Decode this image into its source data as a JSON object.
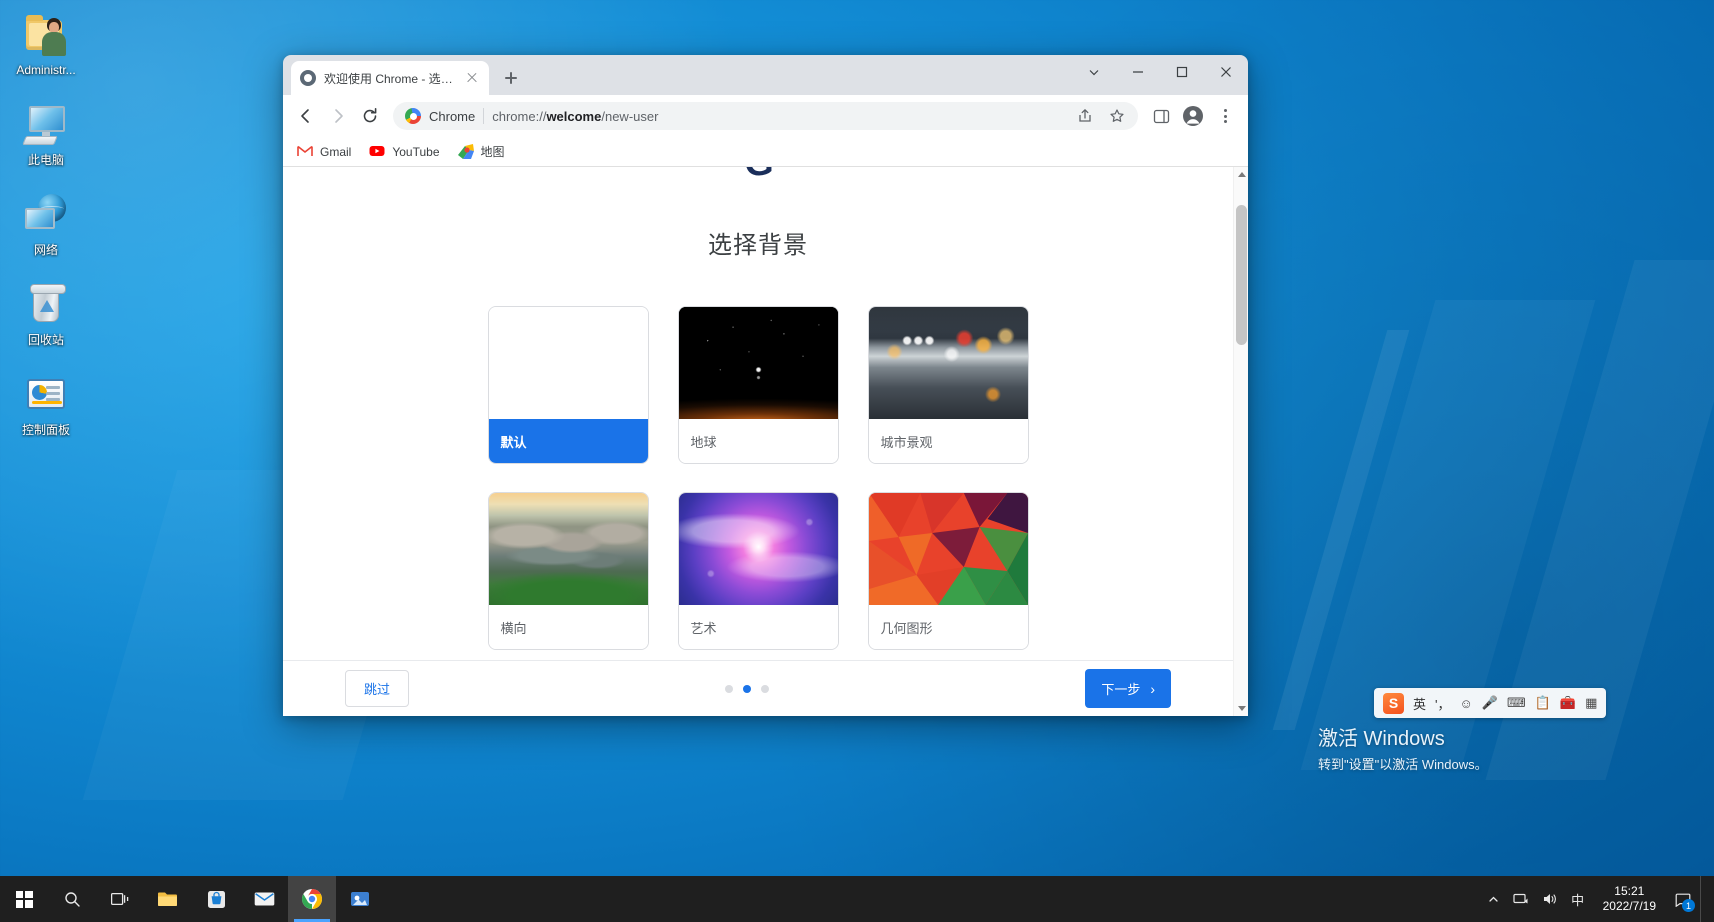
{
  "desktop": {
    "icons": [
      {
        "label": "Administr...",
        "icon": "user-folder-icon"
      },
      {
        "label": "此电脑",
        "icon": "this-pc-icon"
      },
      {
        "label": "网络",
        "icon": "network-icon"
      },
      {
        "label": "回收站",
        "icon": "recycle-bin-icon"
      },
      {
        "label": "控制面板",
        "icon": "control-panel-icon"
      }
    ],
    "watermark": {
      "title": "激活 Windows",
      "subtitle": "转到\"设置\"以激活 Windows。"
    }
  },
  "browser": {
    "tab": {
      "title": "欢迎使用 Chrome - 选择背景",
      "favicon": "chrome-icon",
      "close_icon": "close-icon"
    },
    "new_tab_icon": "plus-icon",
    "window_controls": {
      "minimize_to_tray_icon": "chevron-down-icon",
      "minimize_icon": "minimize-icon",
      "maximize_icon": "maximize-icon",
      "close_icon": "close-icon"
    },
    "toolbar": {
      "back_icon": "arrow-left-icon",
      "forward_icon": "arrow-right-icon",
      "reload_icon": "reload-icon",
      "omnibox": {
        "site_icon": "chrome-icon",
        "brand": "Chrome",
        "url_prefix": "chrome://",
        "url_bold": "welcome",
        "url_suffix": "/new-user",
        "full_url": "chrome://welcome/new-user"
      },
      "share_icon": "share-icon",
      "bookmark_icon": "star-icon",
      "sidepanel_icon": "side-panel-icon",
      "profile_icon": "avatar-icon",
      "menu_icon": "kebab-menu-icon"
    },
    "bookmarks": [
      {
        "label": "Gmail",
        "icon": "gmail-icon"
      },
      {
        "label": "YouTube",
        "icon": "youtube-icon"
      },
      {
        "label": "地图",
        "icon": "google-maps-icon"
      }
    ]
  },
  "page": {
    "logo_mark": "G",
    "title": "选择背景",
    "cards": [
      {
        "label": "默认",
        "thumb": "th-default",
        "selected": true
      },
      {
        "label": "地球",
        "thumb": "th-earth",
        "selected": false
      },
      {
        "label": "城市景观",
        "thumb": "th-city",
        "selected": false
      },
      {
        "label": "横向",
        "thumb": "th-landscape",
        "selected": false
      },
      {
        "label": "艺术",
        "thumb": "th-art",
        "selected": false
      },
      {
        "label": "几何图形",
        "thumb": "th-geo",
        "selected": false
      }
    ],
    "footer": {
      "skip_label": "跳过",
      "next_label": "下一步",
      "next_chevron": "›",
      "dots_total": 3,
      "dots_active_index": 1
    },
    "scrollbar": {
      "up_icon": "caret-up-icon",
      "down_icon": "caret-down-icon"
    }
  },
  "ime": {
    "logo": "S",
    "mode": "英",
    "items": [
      "英",
      "'，"
    ],
    "icons": [
      "smiley-icon",
      "microphone-icon",
      "keyboard-icon",
      "clipboard-icon",
      "toolbox-icon",
      "apps-icon"
    ]
  },
  "taskbar": {
    "start_icon": "windows-logo-icon",
    "items": [
      {
        "icon": "search-icon",
        "name": "search"
      },
      {
        "icon": "task-view-icon",
        "name": "task-view"
      },
      {
        "icon": "file-explorer-icon",
        "name": "file-explorer"
      },
      {
        "icon": "microsoft-store-icon",
        "name": "microsoft-store"
      },
      {
        "icon": "mail-icon",
        "name": "mail"
      },
      {
        "icon": "chrome-icon",
        "name": "chrome",
        "active": true
      },
      {
        "icon": "app-icon",
        "name": "pinned-app"
      }
    ],
    "tray": {
      "overflow_icon": "chevron-up-icon",
      "network_icon": "network-tray-icon",
      "volume_icon": "volume-icon",
      "ime_label": "中",
      "time": "15:21",
      "date": "2022/7/19",
      "notification_count": "1"
    }
  },
  "colors": {
    "accent_blue": "#1a73e8",
    "desktop_blue": "#0b7ac4",
    "taskbar": "#1f1f1f",
    "selected_card": "#1a73e8"
  }
}
